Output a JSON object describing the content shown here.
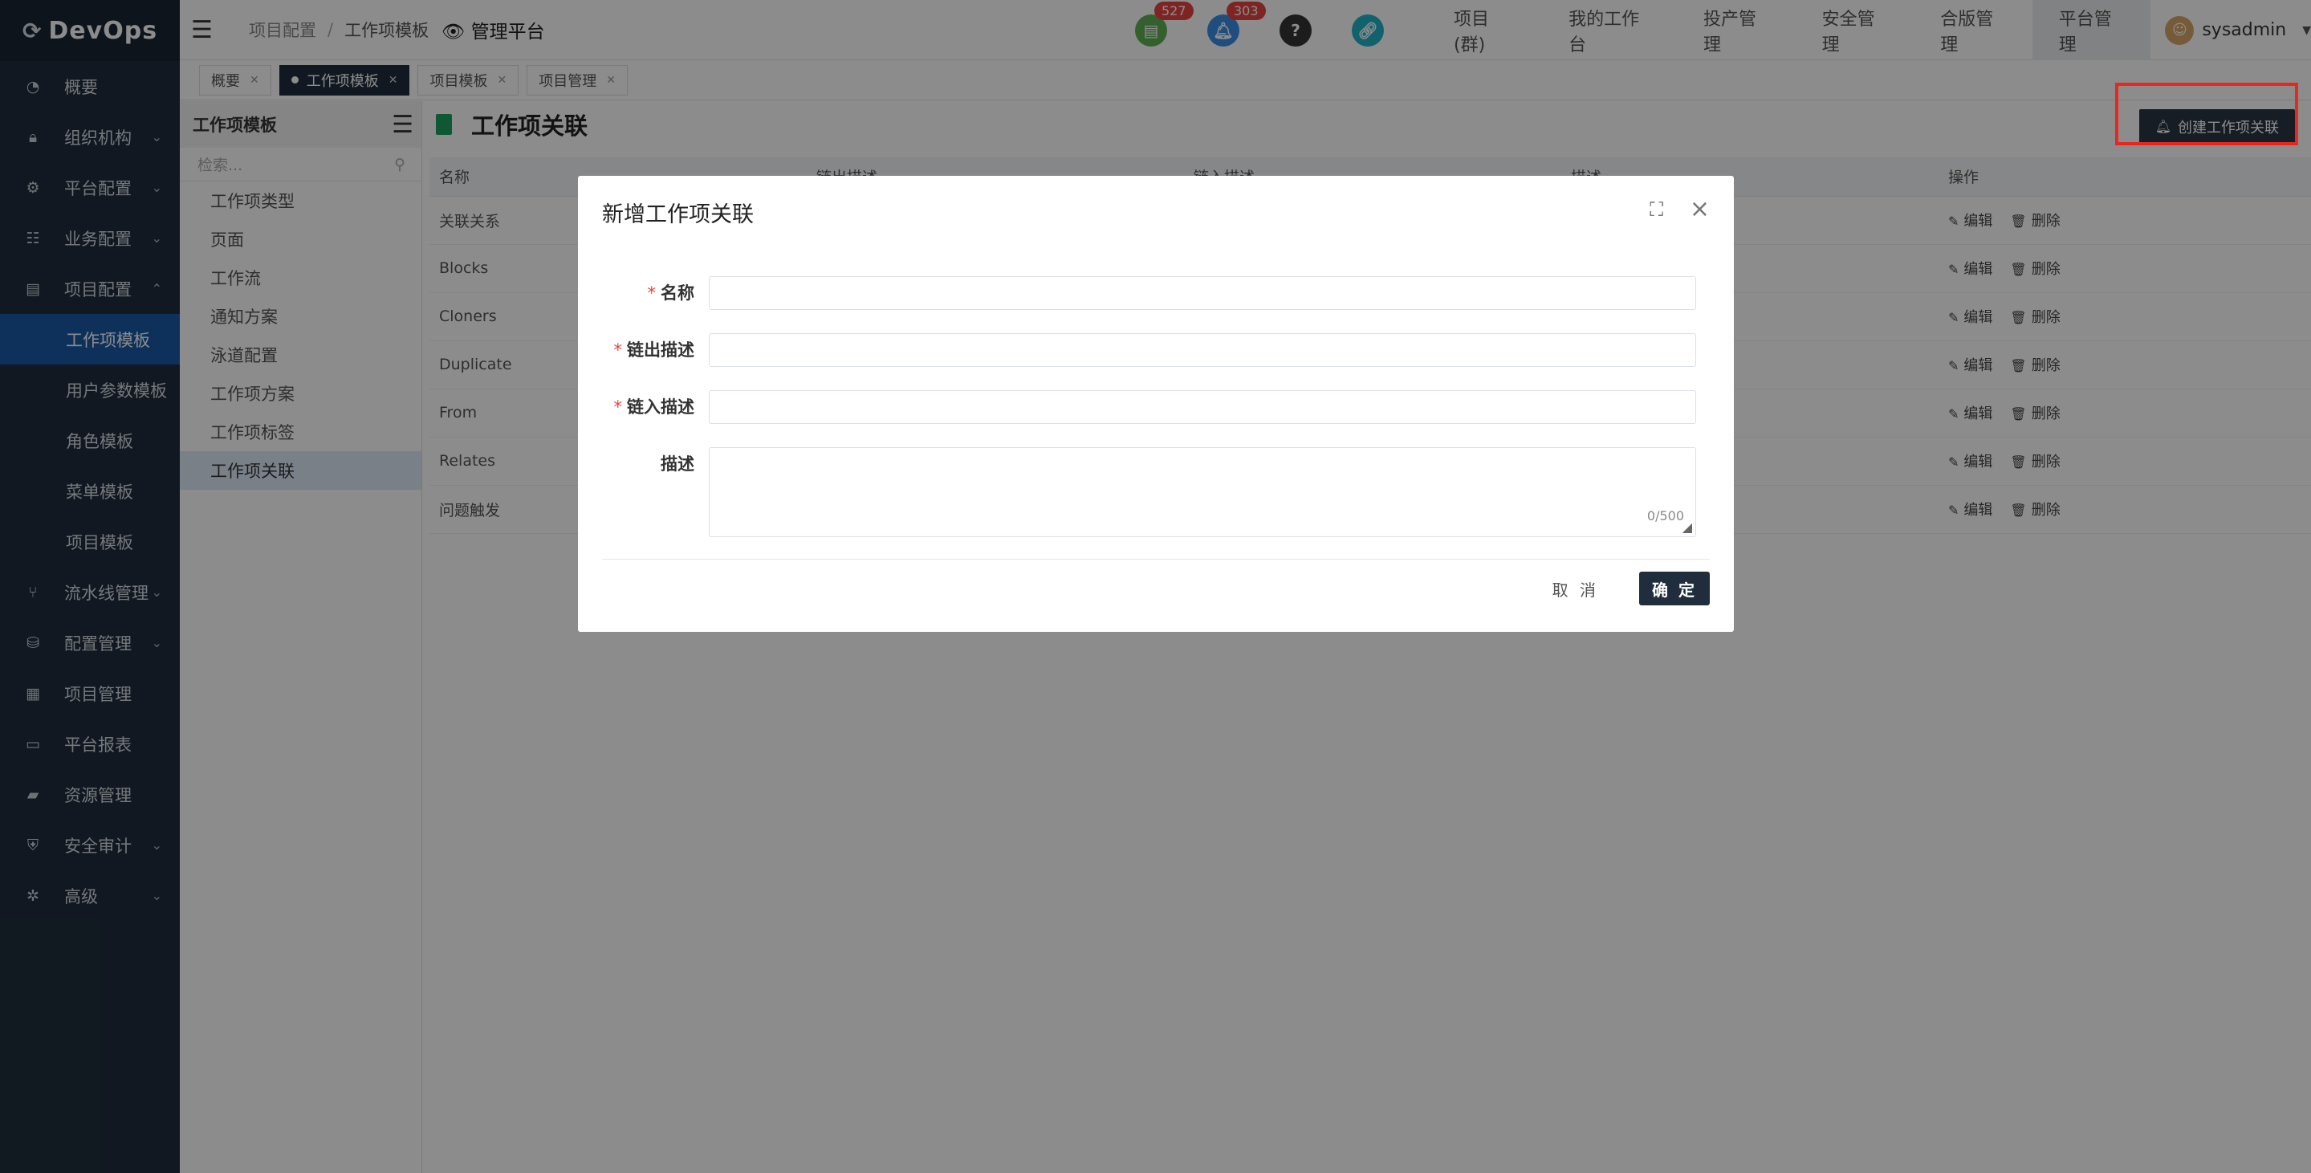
{
  "app": {
    "logo_text": "DevOps"
  },
  "sidebar": {
    "items": [
      {
        "label": "概要",
        "icon": "dashboard-icon"
      },
      {
        "label": "组织机构",
        "icon": "lock-icon",
        "chevron": "down"
      },
      {
        "label": "平台配置",
        "icon": "gear-icon",
        "chevron": "down"
      },
      {
        "label": "业务配置",
        "icon": "sliders-icon",
        "chevron": "down"
      },
      {
        "label": "项目配置",
        "icon": "cards-icon",
        "chevron": "up"
      }
    ],
    "sub_items": [
      {
        "label": "工作项模板",
        "active": true
      },
      {
        "label": "用户参数模板"
      },
      {
        "label": "角色模板"
      },
      {
        "label": "菜单模板"
      },
      {
        "label": "项目模板"
      }
    ],
    "items_after": [
      {
        "label": "流水线管理",
        "icon": "pipeline-icon",
        "chevron": "down"
      },
      {
        "label": "配置管理",
        "icon": "database-icon",
        "chevron": "down"
      },
      {
        "label": "项目管理",
        "icon": "grid-icon"
      },
      {
        "label": "平台报表",
        "icon": "monitor-icon"
      },
      {
        "label": "资源管理",
        "icon": "folder-icon"
      },
      {
        "label": "安全审计",
        "icon": "shield-icon",
        "chevron": "down"
      },
      {
        "label": "高级",
        "icon": "cog-advanced-icon",
        "chevron": "down"
      }
    ]
  },
  "topbar": {
    "breadcrumb": [
      "项目配置",
      "工作项模板"
    ],
    "platform_label": "管理平台",
    "badges": [
      {
        "name": "todo",
        "count": "527",
        "color": "#5fb054",
        "icon": "document-icon"
      },
      {
        "name": "notice",
        "count": "303",
        "color": "#3a8ee6",
        "icon": "bell-icon"
      },
      {
        "name": "help",
        "color": "#333333",
        "icon": "question-icon"
      },
      {
        "name": "link",
        "color": "#22b3c6",
        "icon": "link-icon"
      }
    ],
    "nav": [
      "项目(群)",
      "我的工作台",
      "投产管理",
      "安全管理",
      "合版管理",
      "平台管理"
    ],
    "active_nav": "平台管理",
    "user": "sysadmin"
  },
  "tabs": [
    {
      "label": "概要"
    },
    {
      "label": "工作项模板",
      "active": true
    },
    {
      "label": "项目模板"
    },
    {
      "label": "项目管理"
    }
  ],
  "submenu": {
    "title": "工作项模板",
    "search_placeholder": "检索...",
    "items": [
      "工作项类型",
      "页面",
      "工作流",
      "通知方案",
      "泳道配置",
      "工作项方案",
      "工作项标签",
      "工作项关联"
    ],
    "active": "工作项关联"
  },
  "main": {
    "title": "工作项关联",
    "create_button": "创建工作项关联",
    "columns": [
      "名称",
      "链出描述",
      "链入描述",
      "描述",
      "操作"
    ],
    "rows": [
      "关联关系",
      "Blocks",
      "Cloners",
      "Duplicate",
      "From",
      "Relates",
      "问题触发"
    ],
    "actions": {
      "edit": "编辑",
      "delete": "删除"
    }
  },
  "modal": {
    "title": "新增工作项关联",
    "fields": [
      {
        "label": "名称",
        "required": true,
        "value": ""
      },
      {
        "label": "链出描述",
        "required": true,
        "value": ""
      },
      {
        "label": "链入描述",
        "required": true,
        "value": ""
      },
      {
        "label": "描述",
        "required": false,
        "value": "",
        "counter": "0/500"
      }
    ],
    "cancel_label": "取 消",
    "ok_label": "确 定"
  }
}
